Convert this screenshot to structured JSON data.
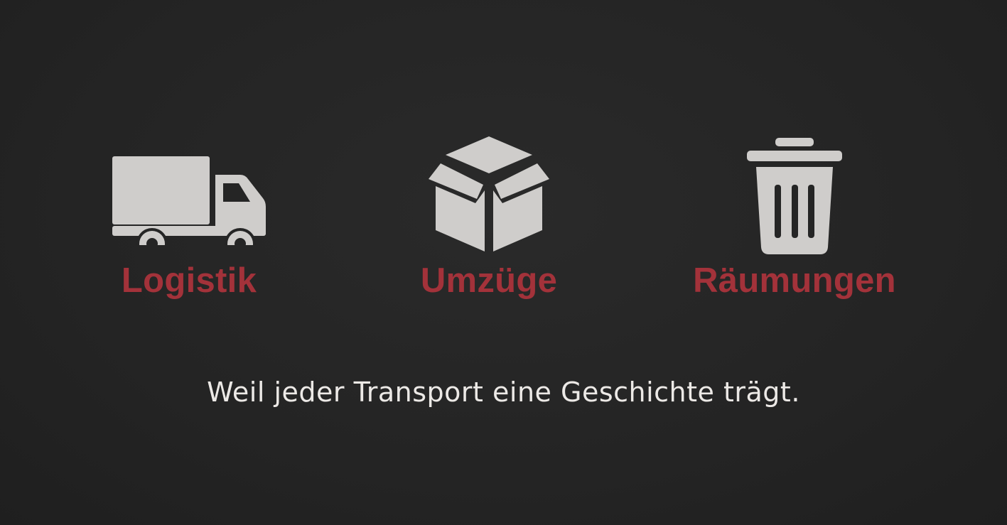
{
  "colors": {
    "background": "#252525",
    "accent": "#a3323a",
    "icon": "#cfcdcb",
    "text": "#ece9e6"
  },
  "services": [
    {
      "icon": "truck-icon",
      "label": "Logistik"
    },
    {
      "icon": "box-icon",
      "label": "Umzüge"
    },
    {
      "icon": "trash-can-icon",
      "label": "Räumungen"
    }
  ],
  "tagline": "Weil jeder Transport eine Geschichte trägt."
}
